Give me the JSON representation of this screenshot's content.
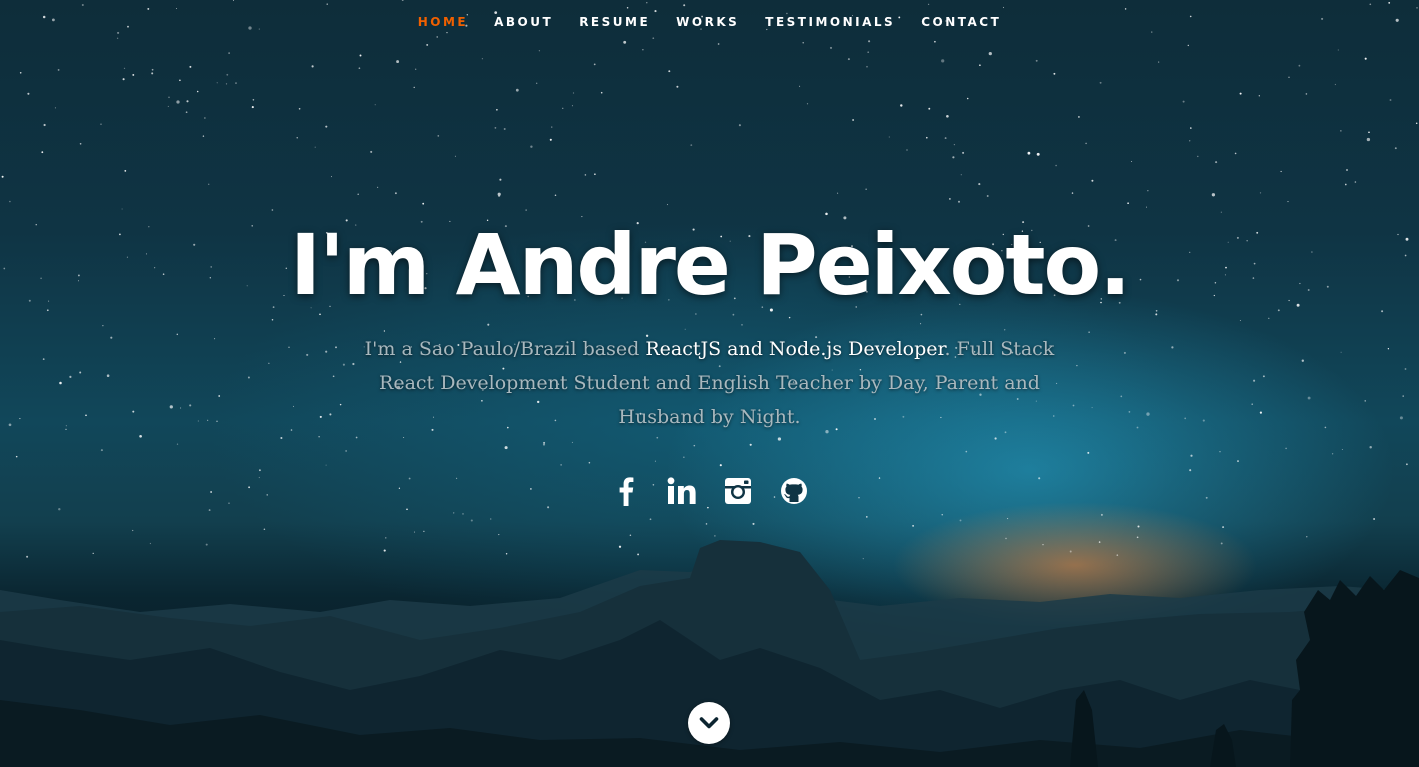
{
  "nav": {
    "items": [
      {
        "label": "HOME",
        "active": true
      },
      {
        "label": "ABOUT",
        "active": false
      },
      {
        "label": "RESUME",
        "active": false
      },
      {
        "label": "WORKS",
        "active": false
      },
      {
        "label": "TESTIMONIALS",
        "active": false
      },
      {
        "label": "CONTACT",
        "active": false
      }
    ],
    "active_color": "#f06000"
  },
  "banner": {
    "headline": "I'm Andre Peixoto.",
    "intro_before": "I'm a Sao Paulo/Brazil based ",
    "intro_highlight": "ReactJS and Node.js Developer",
    "intro_after": ". Full Stack React Development Student and English Teacher by Day, Parent and Husband by Night."
  },
  "social": [
    {
      "icon": "facebook-icon"
    },
    {
      "icon": "linkedin-icon"
    },
    {
      "icon": "instagram-icon"
    },
    {
      "icon": "github-icon"
    }
  ],
  "scroll_down": {
    "icon": "chevron-down-icon"
  }
}
